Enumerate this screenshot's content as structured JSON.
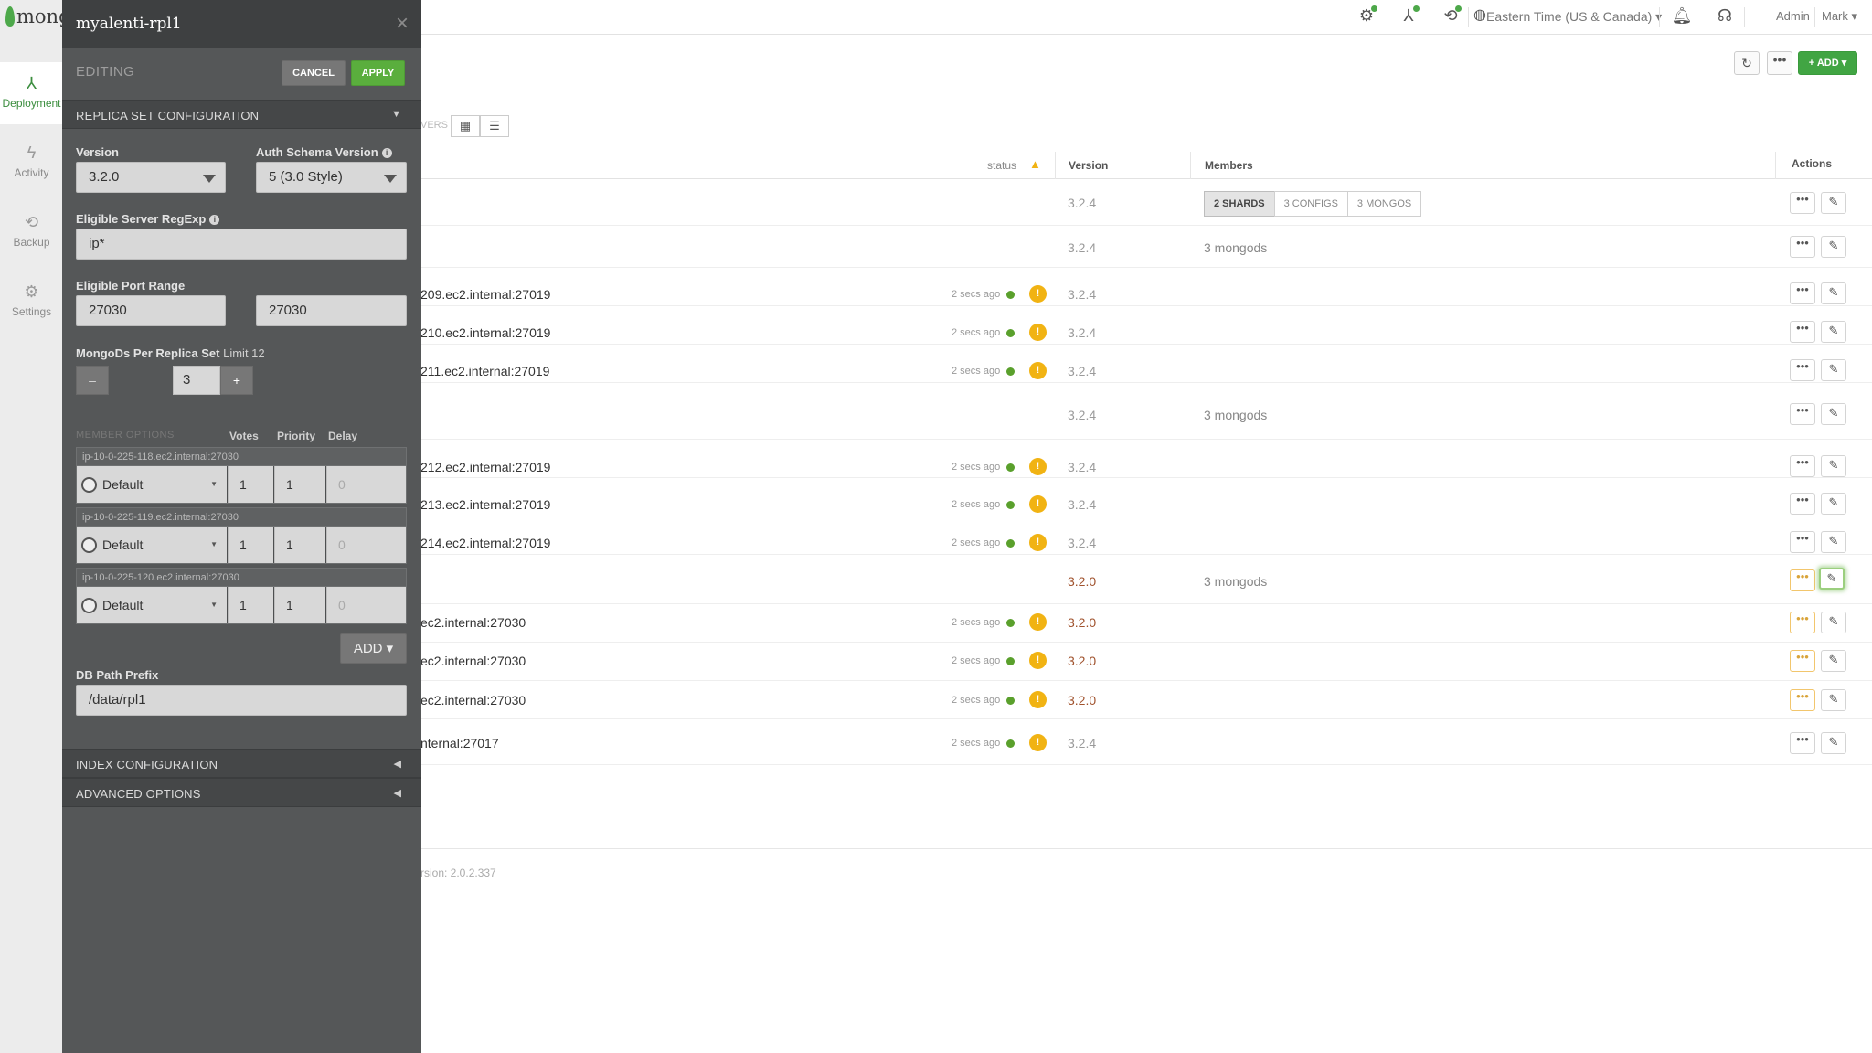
{
  "leftnav": {
    "logo_text": "mong",
    "items": [
      {
        "label": "Deployment",
        "icon": "deployment-icon"
      },
      {
        "label": "Activity",
        "icon": "activity-icon"
      },
      {
        "label": "Backup",
        "icon": "backup-icon"
      },
      {
        "label": "Settings",
        "icon": "settings-icon"
      }
    ]
  },
  "topbar": {
    "timezone": "Eastern Time (US & Canada)",
    "admin": "Admin",
    "user": "Mark"
  },
  "toolbar": {
    "add_label": "+ ADD",
    "view_label": "VERS"
  },
  "table": {
    "headers": {
      "status": "status",
      "version": "Version",
      "members": "Members",
      "actions": "Actions"
    },
    "cluster_row": {
      "version": "3.2.4",
      "segments": [
        "2 SHARDS",
        "3 CONFIGS",
        "3 MONGOS"
      ]
    },
    "rows": [
      {
        "host": "",
        "ago": "",
        "version": "3.2.4",
        "members": "3 mongods"
      },
      {
        "host": "209.ec2.internal:27019",
        "ago": "2 secs ago",
        "version": "3.2.4",
        "members": ""
      },
      {
        "host": "210.ec2.internal:27019",
        "ago": "2 secs ago",
        "version": "3.2.4",
        "members": ""
      },
      {
        "host": "211.ec2.internal:27019",
        "ago": "2 secs ago",
        "version": "3.2.4",
        "members": ""
      },
      {
        "host": "",
        "ago": "",
        "version": "3.2.4",
        "members": "3 mongods"
      },
      {
        "host": "212.ec2.internal:27019",
        "ago": "2 secs ago",
        "version": "3.2.4",
        "members": ""
      },
      {
        "host": "213.ec2.internal:27019",
        "ago": "2 secs ago",
        "version": "3.2.4",
        "members": ""
      },
      {
        "host": "214.ec2.internal:27019",
        "ago": "2 secs ago",
        "version": "3.2.4",
        "members": ""
      },
      {
        "host": "",
        "ago": "",
        "version": "3.2.0",
        "members": "3 mongods"
      },
      {
        "host": "ec2.internal:27030",
        "ago": "2 secs ago",
        "version": "3.2.0",
        "members": ""
      },
      {
        "host": "ec2.internal:27030",
        "ago": "2 secs ago",
        "version": "3.2.0",
        "members": ""
      },
      {
        "host": "ec2.internal:27030",
        "ago": "2 secs ago",
        "version": "3.2.0",
        "members": ""
      },
      {
        "host": "nternal:27017",
        "ago": "2 secs ago",
        "version": "3.2.4",
        "members": ""
      }
    ],
    "warn_badge": "!",
    "more_glyph": "•••",
    "edit_glyph": "✎"
  },
  "footer": {
    "version_text": "rsion: 2.0.2.337"
  },
  "panel": {
    "title": "myalenti-rpl1",
    "editing_label": "EDITING",
    "cancel_label": "CANCEL",
    "apply_label": "APPLY",
    "sections": {
      "replica": "REPLICA SET CONFIGURATION",
      "index": "INDEX CONFIGURATION",
      "advanced": "ADVANCED OPTIONS"
    },
    "version": {
      "label": "Version",
      "value": "3.2.0"
    },
    "auth_schema": {
      "label": "Auth Schema Version",
      "value": "5 (3.0 Style)"
    },
    "regexp": {
      "label": "Eligible Server RegExp",
      "value": "ip*"
    },
    "port_range": {
      "label": "Eligible Port Range",
      "from": "27030",
      "to": "27030"
    },
    "mongods": {
      "label": "MongoDs Per Replica Set",
      "limit": "Limit 12",
      "minus": "–",
      "value": "3",
      "plus": "+"
    },
    "member_options": {
      "label": "MEMBER OPTIONS",
      "votes": "Votes",
      "priority": "Priority",
      "delay": "Delay",
      "members": [
        {
          "host": "ip-10-0-225-118.ec2.internal:27030",
          "type": "Default",
          "votes": "1",
          "priority": "1",
          "delay": "0"
        },
        {
          "host": "ip-10-0-225-119.ec2.internal:27030",
          "type": "Default",
          "votes": "1",
          "priority": "1",
          "delay": "0"
        },
        {
          "host": "ip-10-0-225-120.ec2.internal:27030",
          "type": "Default",
          "votes": "1",
          "priority": "1",
          "delay": "0"
        }
      ]
    },
    "add_label": "ADD",
    "db_path": {
      "label": "DB Path Prefix",
      "value": "/data/rpl1"
    }
  }
}
